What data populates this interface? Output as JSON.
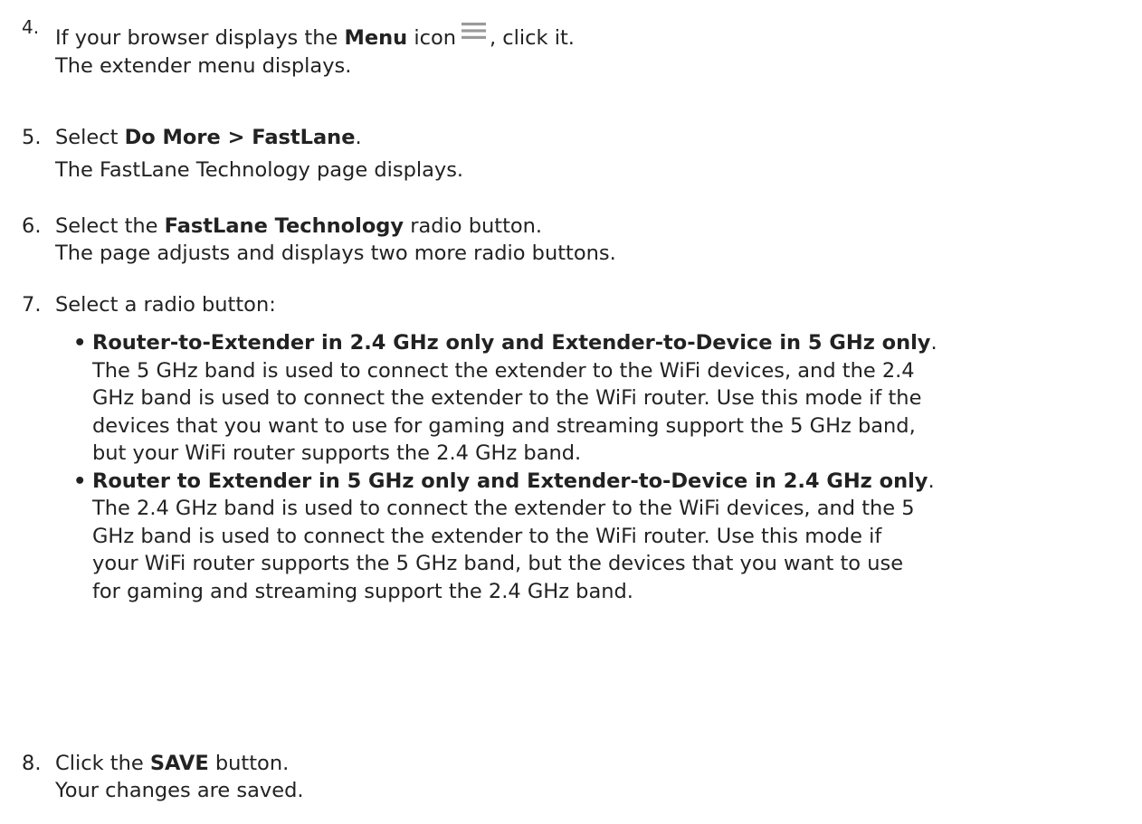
{
  "steps": {
    "s4": {
      "number": "4.",
      "p1": "If your browser displays the ",
      "b1": "Menu",
      "p2": " icon",
      "p3": ", click it.",
      "result": "The extender menu displays.",
      "icon": "hamburger-menu-icon"
    },
    "s5": {
      "number": "5.",
      "p1": "Select ",
      "b1": "Do More > FastLane",
      "p2": ".",
      "result": "The FastLane Technology page displays."
    },
    "s6": {
      "number": "6.",
      "p1": "Select the ",
      "b1": "FastLane Technology",
      "p2": " radio button.",
      "result": "The page adjusts and displays two more radio buttons."
    },
    "s7": {
      "number": "7.",
      "text": "Select a radio button:",
      "bullets": [
        {
          "bullet": "•",
          "title": "Router-to-Extender in 2.4 GHz only and Extender-to-Device in 5 GHz only",
          "suffix": ".",
          "lines": [
            "The 5 GHz band is used to connect the extender to the WiFi devices, and the 2.4",
            "GHz band is used to connect the extender to the WiFi router. Use this mode if the",
            "devices that you want to use for gaming and streaming support the 5 GHz band,",
            "but your WiFi router supports the 2.4 GHz band."
          ]
        },
        {
          "bullet": "•",
          "title": "Router to Extender in 5 GHz only and Extender-to-Device in 2.4 GHz only",
          "suffix": ".",
          "lines": [
            "The 2.4 GHz band is used to connect the extender to the WiFi devices, and the 5",
            "GHz band is used to connect the extender to the WiFi router. Use this mode if",
            "your WiFi router supports the 5 GHz band, but the devices that you want to use",
            "for gaming and streaming support the 2.4 GHz band."
          ]
        }
      ]
    },
    "s8": {
      "number": "8.",
      "p1": "Click the ",
      "b1": "SAVE",
      "p2": " button.",
      "result": "Your changes are saved."
    }
  },
  "colors": {
    "text": "#222222",
    "icon": "#9a9a9a",
    "background": "#ffffff"
  }
}
